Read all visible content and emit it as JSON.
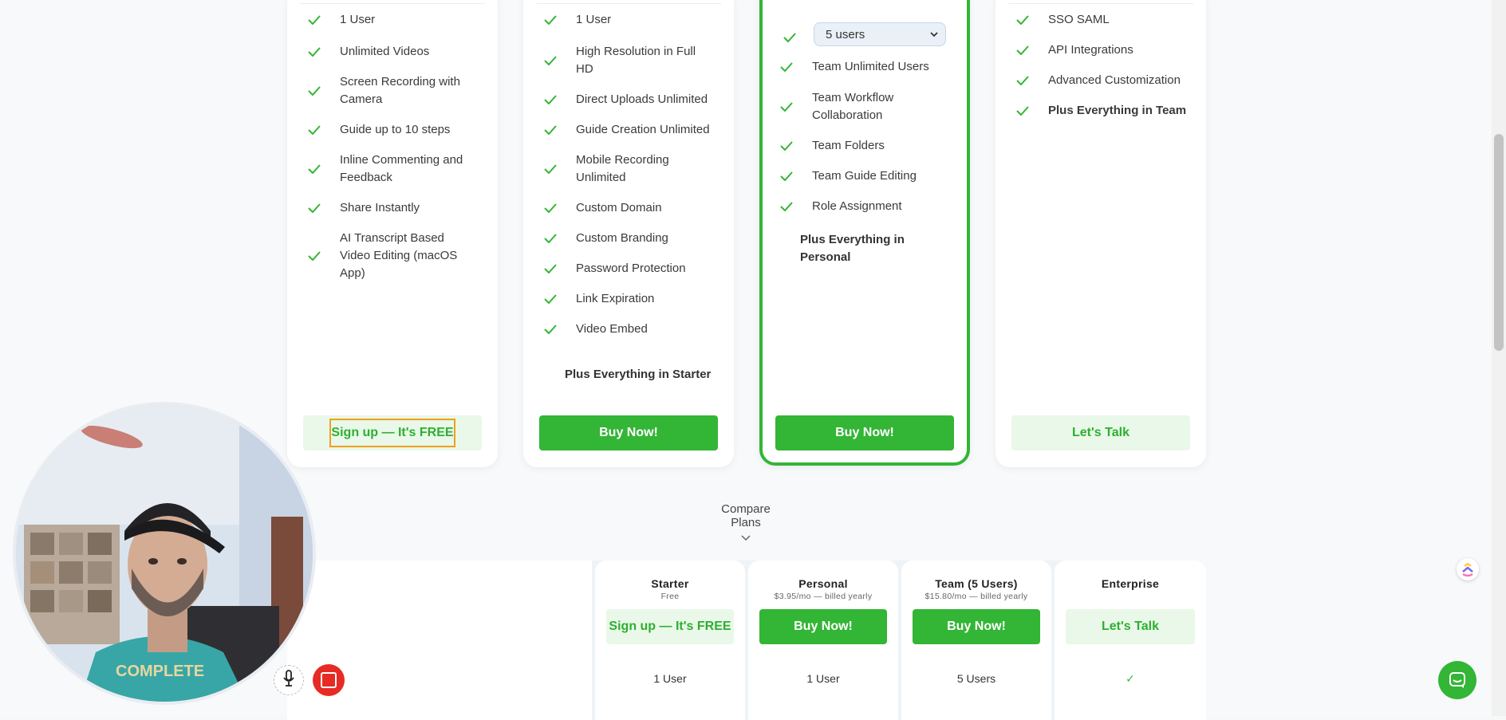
{
  "plans": [
    {
      "features": [
        "1 User",
        "Unlimited Videos",
        "Screen Recording with Camera",
        "Guide up to 10 steps",
        "Inline Commenting and Feedback",
        "Share Instantly",
        "AI Transcript Based Video Editing (macOS App)"
      ],
      "cta": "Sign up — It's FREE"
    },
    {
      "features": [
        "1 User",
        "High Resolution in Full HD",
        "Direct Uploads Unlimited",
        "Guide Creation Unlimited",
        "Mobile Recording Unlimited",
        "Custom Domain",
        "Custom Branding",
        "Password Protection",
        "Link Expiration",
        "Video Embed"
      ],
      "plus": "Plus Everything in Starter",
      "cta": "Buy Now!"
    },
    {
      "select_value": "5 users",
      "features": [
        "Team Unlimited Users",
        "Team Workflow Collaboration",
        "Team Folders",
        "Team Guide Editing",
        "Role Assignment"
      ],
      "plus": "Plus Everything in Personal",
      "cta": "Buy Now!"
    },
    {
      "features": [
        "SSO SAML",
        "API Integrations",
        "Advanced Customization"
      ],
      "plus": "Plus Everything in Team",
      "cta": "Let's Talk"
    }
  ],
  "compare": {
    "label": "Compare Plans"
  },
  "table": {
    "columns": [
      {
        "name": "Starter",
        "sub": "Free",
        "cta": "Sign up — It's FREE",
        "row1": "1 User"
      },
      {
        "name": "Personal",
        "sub": "$3.95/mo — billed yearly",
        "cta": "Buy Now!",
        "row1": "1 User"
      },
      {
        "name": "Team (5 Users)",
        "sub": "$15.80/mo — billed yearly",
        "cta": "Buy Now!",
        "row1": "5 Users"
      },
      {
        "name": "Enterprise",
        "sub": "",
        "cta": "Let's Talk",
        "row1": "✓"
      }
    ]
  },
  "colors": {
    "accent": "#33b536",
    "accent_light": "#e9f8e8",
    "stop": "#e62b25"
  }
}
